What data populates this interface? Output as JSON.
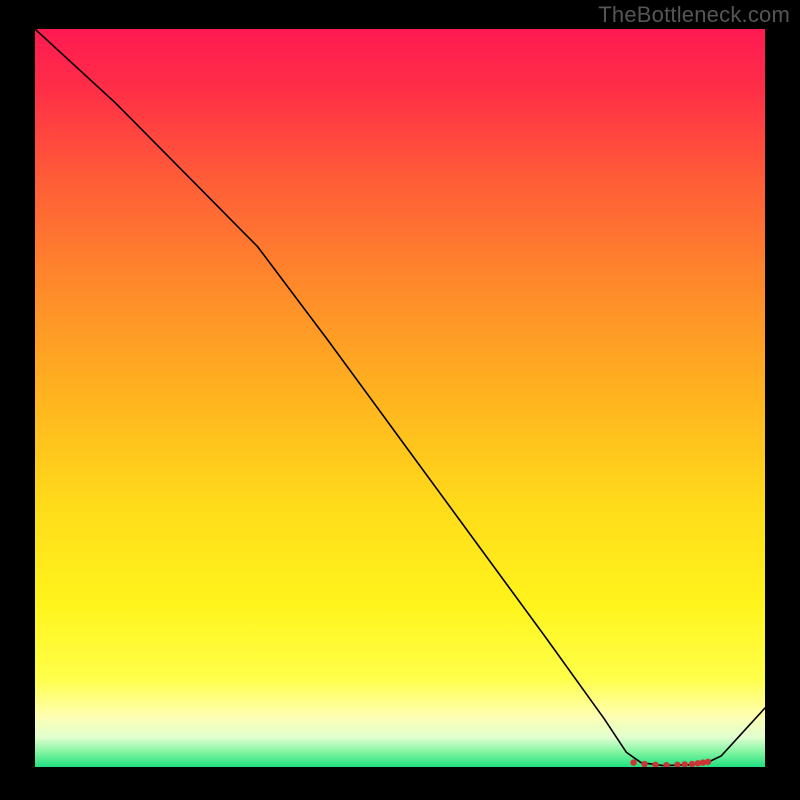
{
  "attribution": "TheBottleneck.com",
  "chart_data": {
    "type": "line",
    "title": "",
    "xlabel": "",
    "ylabel": "",
    "xlim": [
      0,
      100
    ],
    "ylim": [
      0,
      100
    ],
    "background_gradient": {
      "stops": [
        {
          "offset": 0.0,
          "color": "#ff1a52"
        },
        {
          "offset": 0.08,
          "color": "#ff2e47"
        },
        {
          "offset": 0.2,
          "color": "#ff5b38"
        },
        {
          "offset": 0.35,
          "color": "#ff8a2a"
        },
        {
          "offset": 0.5,
          "color": "#ffb41f"
        },
        {
          "offset": 0.65,
          "color": "#ffdc1a"
        },
        {
          "offset": 0.78,
          "color": "#fff41c"
        },
        {
          "offset": 0.88,
          "color": "#ffff4a"
        },
        {
          "offset": 0.93,
          "color": "#ffffb0"
        },
        {
          "offset": 0.96,
          "color": "#e0ffd0"
        },
        {
          "offset": 0.98,
          "color": "#80f5a0"
        },
        {
          "offset": 1.0,
          "color": "#20e080"
        }
      ]
    },
    "series": [
      {
        "name": "bottleneck-curve",
        "color": "#000000",
        "points": [
          {
            "x": 0.0,
            "y": 100.0
          },
          {
            "x": 11.0,
            "y": 90.0
          },
          {
            "x": 23.0,
            "y": 78.0
          },
          {
            "x": 28.0,
            "y": 73.0
          },
          {
            "x": 30.5,
            "y": 70.5
          },
          {
            "x": 40.0,
            "y": 58.0
          },
          {
            "x": 50.0,
            "y": 44.5
          },
          {
            "x": 60.0,
            "y": 31.0
          },
          {
            "x": 70.0,
            "y": 17.5
          },
          {
            "x": 78.0,
            "y": 6.5
          },
          {
            "x": 81.0,
            "y": 2.0
          },
          {
            "x": 83.0,
            "y": 0.6
          },
          {
            "x": 86.0,
            "y": 0.2
          },
          {
            "x": 90.0,
            "y": 0.3
          },
          {
            "x": 92.5,
            "y": 0.8
          },
          {
            "x": 94.0,
            "y": 1.5
          },
          {
            "x": 100.0,
            "y": 8.0
          }
        ]
      }
    ],
    "markers": {
      "name": "highlighted-range",
      "color": "#cc3333",
      "points": [
        {
          "x": 82.0,
          "y": 0.6
        },
        {
          "x": 83.5,
          "y": 0.4
        },
        {
          "x": 85.0,
          "y": 0.3
        },
        {
          "x": 86.5,
          "y": 0.25
        },
        {
          "x": 88.0,
          "y": 0.3
        },
        {
          "x": 89.0,
          "y": 0.35
        },
        {
          "x": 90.0,
          "y": 0.4
        },
        {
          "x": 90.8,
          "y": 0.5
        },
        {
          "x": 91.5,
          "y": 0.6
        },
        {
          "x": 92.2,
          "y": 0.7
        }
      ]
    }
  }
}
